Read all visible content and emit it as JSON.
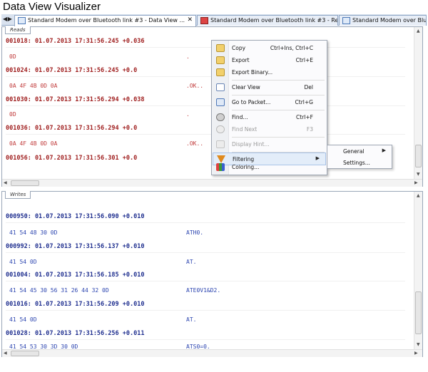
{
  "window": {
    "title": "Data View Visualizer"
  },
  "tabs": [
    {
      "label": "Standard Modem over Bluetooth link #3 - Data View ...",
      "close": "✕"
    },
    {
      "label": "Standard Modem over Bluetooth link #3 - Request ..."
    },
    {
      "label": "Standard Modem over Blu"
    }
  ],
  "reads": {
    "tab_label": "Reads",
    "rows": [
      {
        "header": "001018: 01.07.2013 17:31:56.245 +0.036",
        "hex": "0D",
        "ascii": "."
      },
      {
        "header": "001024: 01.07.2013 17:31:56.245 +0.0",
        "hex": "0A 4F 4B 0D 0A",
        "ascii": ".OK.."
      },
      {
        "header": "001030: 01.07.2013 17:31:56.294 +0.038",
        "hex": "0D",
        "ascii": "."
      },
      {
        "header": "001036: 01.07.2013 17:31:56.294 +0.0",
        "hex": "0A 4F 4B 0D 0A",
        "ascii": ".OK.."
      },
      {
        "header": "001056: 01.07.2013 17:31:56.301 +0.0",
        "hex": "",
        "ascii": ""
      }
    ]
  },
  "writes": {
    "tab_label": "Writes",
    "rows": [
      {
        "header": "000950: 01.07.2013 17:31:56.090 +0.010",
        "hex": "41 54 48 30 0D",
        "ascii": "ATH0."
      },
      {
        "header": "000992: 01.07.2013 17:31:56.137 +0.010",
        "hex": "41 54 0D",
        "ascii": "AT."
      },
      {
        "header": "001004: 01.07.2013 17:31:56.185 +0.010",
        "hex": "41 54 45 30 56 31 26 44 32 0D",
        "ascii": "ATE0V1&D2."
      },
      {
        "header": "001016: 01.07.2013 17:31:56.209 +0.010",
        "hex": "41 54 0D",
        "ascii": "AT."
      },
      {
        "header": "001028: 01.07.2013 17:31:56.256 +0.011",
        "hex": "41 54 53 30 3D 30 0D",
        "ascii": "ATS0=0."
      }
    ]
  },
  "context_menu": {
    "items": [
      {
        "label": "Copy",
        "shortcut": "Ctrl+Ins, Ctrl+C",
        "icon": "copy-icon"
      },
      {
        "label": "Export",
        "shortcut": "Ctrl+E",
        "icon": "export-icon"
      },
      {
        "label": "Export Binary...",
        "shortcut": "",
        "icon": "export-binary-icon"
      },
      {
        "label": "Clear View",
        "shortcut": "Del",
        "icon": "clear-view-icon"
      },
      {
        "label": "Go to Packet...",
        "shortcut": "Ctrl+G",
        "icon": "goto-packet-icon"
      },
      {
        "label": "Find...",
        "shortcut": "Ctrl+F",
        "icon": "find-icon"
      },
      {
        "label": "Find Next",
        "shortcut": "F3",
        "icon": "find-next-icon"
      },
      {
        "label": "Display Hint...",
        "shortcut": "",
        "icon": "display-hint-icon"
      },
      {
        "label": "Filtering",
        "shortcut": "",
        "icon": "filter-icon",
        "submenu_arrow": "▶"
      },
      {
        "label": "Coloring...",
        "shortcut": "",
        "icon": "coloring-icon"
      }
    ]
  },
  "filtering_submenu": {
    "items": [
      {
        "label": "General",
        "submenu_arrow": "▶"
      },
      {
        "label": "Settings..."
      }
    ]
  },
  "scroll_arrows": {
    "up": "▲",
    "down": "▼",
    "left": "◀",
    "right": "▶"
  },
  "tab_nav": "◀ ▶"
}
